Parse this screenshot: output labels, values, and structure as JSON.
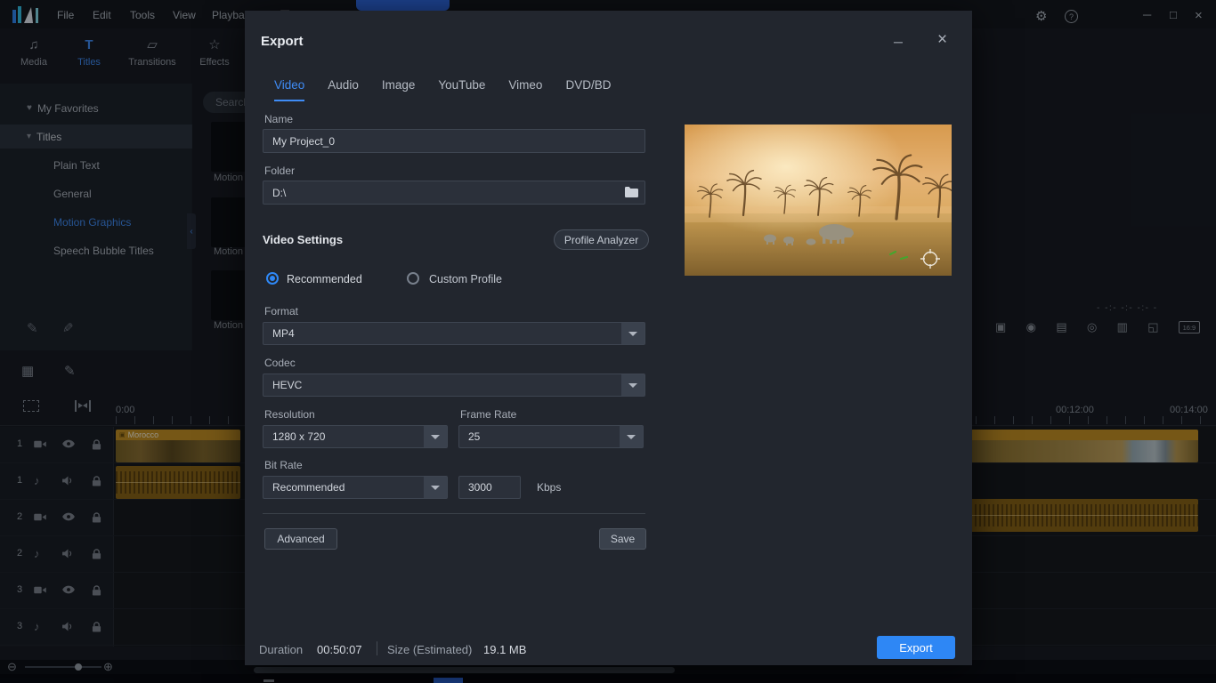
{
  "window": {
    "menu": [
      "File",
      "Edit",
      "Tools",
      "View",
      "Playback"
    ],
    "ribbon_tabs": [
      {
        "label": "Media",
        "active": false
      },
      {
        "label": "Titles",
        "active": true
      },
      {
        "label": "Transitions",
        "active": false
      },
      {
        "label": "Effects",
        "active": false
      }
    ]
  },
  "sidebar": {
    "favorites_label": "My Favorites",
    "group_label": "Titles",
    "items": [
      {
        "label": "Plain Text",
        "active": false
      },
      {
        "label": "General",
        "active": false
      },
      {
        "label": "Motion Graphics",
        "active": true
      },
      {
        "label": "Speech Bubble Titles",
        "active": false
      }
    ]
  },
  "library": {
    "search_placeholder": "Search",
    "thumb_labels": [
      "Motion",
      "Motion",
      "Motion"
    ]
  },
  "timeline": {
    "ruler": {
      "start": "0:00",
      "mid": "00:12:00",
      "end": "00:14:00"
    },
    "timecode_placeholder": "- -:- -:- -:- -",
    "aspect_label": "16:9",
    "clip_label": "Morocco",
    "tracks": [
      {
        "num": "1",
        "type": "video"
      },
      {
        "num": "1",
        "type": "audio"
      },
      {
        "num": "2",
        "type": "video"
      },
      {
        "num": "2",
        "type": "audio"
      },
      {
        "num": "3",
        "type": "video"
      },
      {
        "num": "3",
        "type": "audio"
      }
    ]
  },
  "dialog": {
    "title": "Export",
    "tabs": [
      {
        "label": "Video",
        "active": true
      },
      {
        "label": "Audio",
        "active": false
      },
      {
        "label": "Image",
        "active": false
      },
      {
        "label": "YouTube",
        "active": false
      },
      {
        "label": "Vimeo",
        "active": false
      },
      {
        "label": "DVD/BD",
        "active": false
      }
    ],
    "fields": {
      "name_label": "Name",
      "name_value": "My Project_0",
      "folder_label": "Folder",
      "folder_value": "D:\\"
    },
    "video_settings": {
      "heading": "Video Settings",
      "profile_analyzer": "Profile Analyzer",
      "recommended": "Recommended",
      "custom_profile": "Custom Profile",
      "format_label": "Format",
      "format_value": "MP4",
      "codec_label": "Codec",
      "codec_value": "HEVC",
      "resolution_label": "Resolution",
      "resolution_value": "1280 x 720",
      "framerate_label": "Frame Rate",
      "framerate_value": "25",
      "bitrate_label": "Bit Rate",
      "bitrate_value": "Recommended",
      "bitrate_kbps": "3000",
      "kbps_unit": "Kbps"
    },
    "buttons": {
      "advanced": "Advanced",
      "save": "Save",
      "export": "Export"
    },
    "footer": {
      "duration_label": "Duration",
      "duration_value": "00:50:07",
      "size_label": "Size (Estimated)",
      "size_value": "19.1 MB"
    }
  },
  "colors": {
    "accent": "#2f88f6",
    "clip_orange": "#c8921f"
  }
}
